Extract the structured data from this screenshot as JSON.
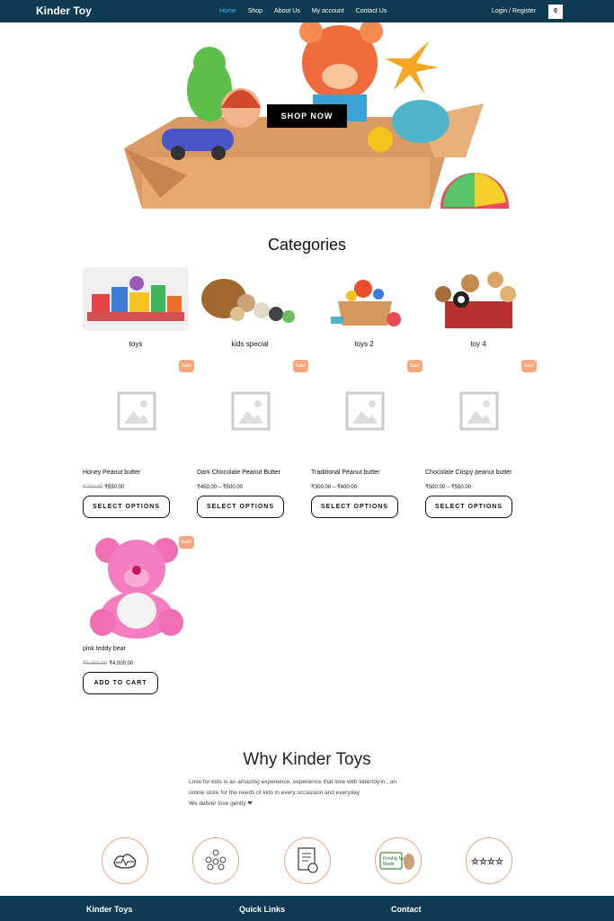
{
  "header": {
    "brand": "Kinder Toy",
    "nav": [
      "Home",
      "Shop",
      "About Us",
      "My account",
      "Contact Us"
    ],
    "login": "Login / Register",
    "cart_count": "0"
  },
  "hero": {
    "button": "SHOP NOW"
  },
  "categories": {
    "title": "Categories",
    "items": [
      "toys",
      "kids special",
      "toys 2",
      "toy 4"
    ]
  },
  "products": [
    {
      "name": "Honey Peanut butter",
      "old_price": "₹700.00",
      "price": "₹550.00",
      "button": "SELECT OPTIONS",
      "badge": "Sale!"
    },
    {
      "name": "Dark Chocolate Peanut Butter",
      "old_price": "",
      "price": "₹450.00 – ₹500.00",
      "button": "SELECT OPTIONS",
      "badge": "Sale!"
    },
    {
      "name": "Traditional Peanut butter",
      "old_price": "",
      "price": "₹300.00 – ₹400.00",
      "button": "SELECT OPTIONS",
      "badge": "Sale!"
    },
    {
      "name": "Chocolate Crispy peanut butter",
      "old_price": "",
      "price": "₹500.00 – ₹550.00",
      "button": "SELECT OPTIONS",
      "badge": "Sale!"
    },
    {
      "name": "pink teddy bear",
      "old_price": "₹5,000.00",
      "price": "₹4,000.00",
      "button": "ADD TO CART",
      "badge": "Sale!"
    }
  ],
  "why": {
    "title": "Why Kinder Toys",
    "line1": "Love for kids is an amazing experience, experience that love with kidertoy.in , an",
    "line2": "online store for the needs of kids in every occassion and everyday",
    "line3": "We deliver love gently ❤",
    "icons": [
      "strength-icon",
      "community-icon",
      "certificate-icon",
      "freshly-made-icon",
      "rating-stars-icon"
    ],
    "freshly_made": "Freshly Made"
  },
  "footer": {
    "col1": "Kinder Toys",
    "col2": "Quick Links",
    "col3": "Contact"
  },
  "colors": {
    "header_bg": "#0e3b52",
    "nav_active": "#3db5e6",
    "sale_badge": "#f4a77a",
    "icon_ring": "#f0a27a"
  }
}
